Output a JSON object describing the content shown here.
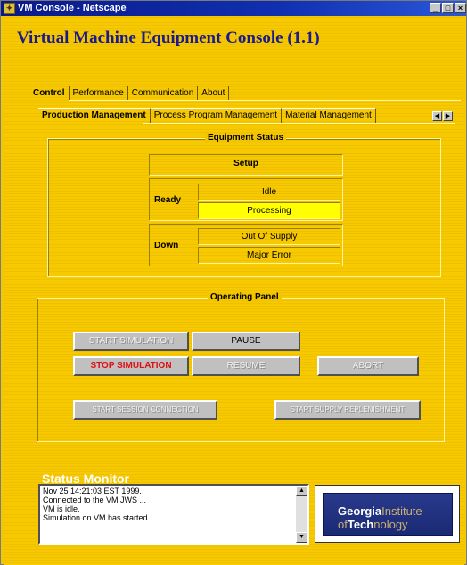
{
  "window": {
    "title": "VM Console - Netscape"
  },
  "app": {
    "title": "Virtual Machine Equipment Console (1.1)"
  },
  "main_tabs": [
    {
      "label": "Control"
    },
    {
      "label": "Performance"
    },
    {
      "label": "Communication"
    },
    {
      "label": "About"
    }
  ],
  "sub_tabs": [
    {
      "label": "Production Management"
    },
    {
      "label": "Process Program Management"
    },
    {
      "label": "Material Management"
    }
  ],
  "equipment_status": {
    "title": "Equipment Status",
    "setup": "Setup",
    "ready_label": "Ready",
    "ready_states": [
      "Idle",
      "Processing"
    ],
    "active_state": "Processing",
    "down_label": "Down",
    "down_states": [
      "Out Of Supply",
      "Major Error"
    ]
  },
  "operating_panel": {
    "title": "Operating Panel",
    "start_simulation": "START SIMULATION",
    "pause": "PAUSE",
    "stop_simulation": "STOP SIMULATION",
    "resume": "RESUME",
    "abort": "ABORT",
    "start_session": "START SESSION CONNECTION",
    "start_supply": "START SUPPLY REPLENISHMENT"
  },
  "status_monitor": {
    "title": "Status Monitor",
    "lines": [
      "Nov 25 14:21:03 EST 1999.",
      "Connected to the VM JWS ...",
      "VM is idle.",
      "Simulation on VM has started."
    ]
  },
  "logo": {
    "line1_bold": "Georgia",
    "line1_light": "Institute",
    "line2_light": "of",
    "line2_bold": "Tech",
    "line2_light2": "nology"
  },
  "colors": {
    "background": "#f3c800",
    "active_state": "#ffff00",
    "title_blue": "#1a1a8c",
    "stop_red": "#e01010"
  }
}
